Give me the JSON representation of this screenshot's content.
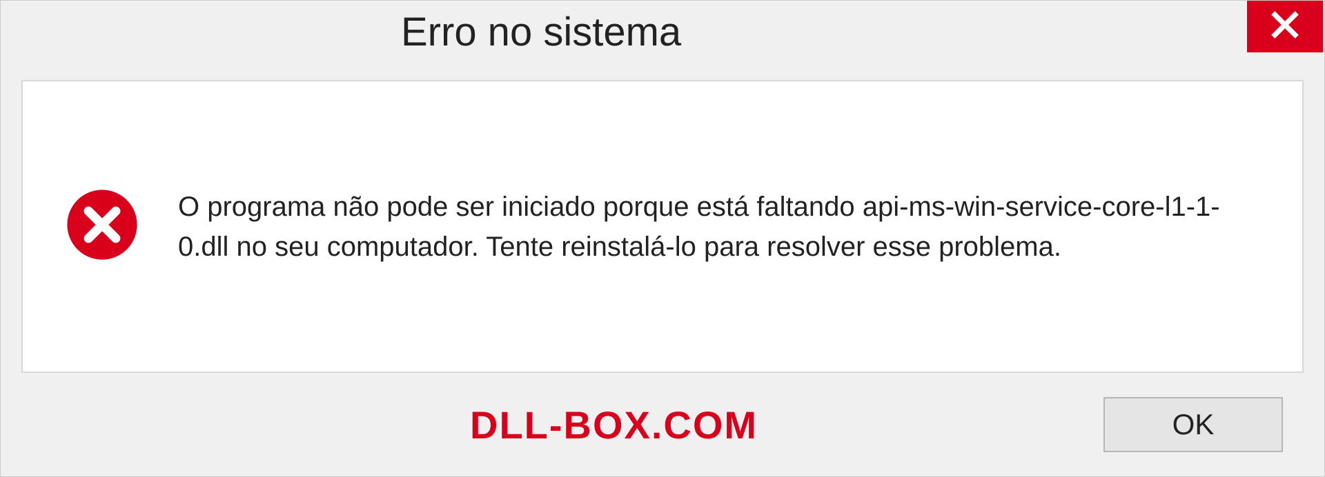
{
  "titlebar": {
    "title": "Erro no sistema"
  },
  "content": {
    "message": "O programa não pode ser iniciado porque está faltando api-ms-win-service-core-l1-1-0.dll no seu computador. Tente reinstalá-lo para resolver esse problema."
  },
  "footer": {
    "branding": "DLL-BOX.COM",
    "ok_label": "OK"
  },
  "colors": {
    "error_red": "#d9001b",
    "dialog_bg": "#f0f0f0",
    "panel_border": "#d8d8d8"
  }
}
